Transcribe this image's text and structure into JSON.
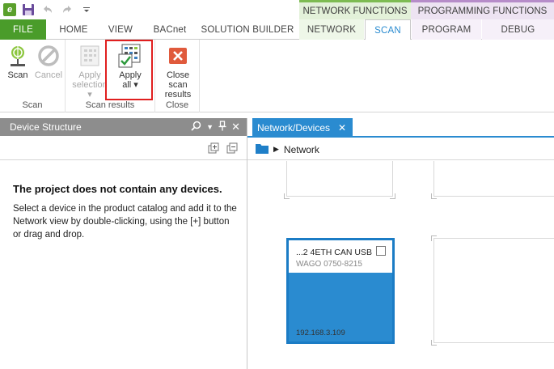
{
  "quick_access": {
    "icons": [
      "app-logo",
      "save-icon",
      "undo-icon",
      "redo-icon",
      "customize-dropdown-icon"
    ],
    "app_logo_text": "e"
  },
  "context_groups": {
    "network_functions": "NETWORK FUNCTIONS",
    "programming_functions": "PROGRAMMING FUNCTIONS"
  },
  "tabs": {
    "file": "FILE",
    "home": "HOME",
    "view": "VIEW",
    "bacnet": "BACnet",
    "solution_builder": "SOLUTION BUILDER",
    "network": "NETWORK",
    "scan": "SCAN",
    "program": "PROGRAM",
    "debug": "DEBUG",
    "active": "SCAN"
  },
  "ribbon": {
    "scan_group": {
      "label": "Scan",
      "scan_button": "Scan",
      "cancel_button": "Cancel"
    },
    "scan_results_group": {
      "label": "Scan results",
      "apply_selection_line1": "Apply",
      "apply_selection_line2": "selection",
      "apply_all_line1": "Apply",
      "apply_all_line2": "all"
    },
    "close_group": {
      "label": "Close",
      "close_scan_line1": "Close scan",
      "close_scan_line2": "results"
    }
  },
  "device_structure": {
    "title": "Device Structure",
    "empty_title": "The project does not contain any devices.",
    "empty_text": "Select a device in the product catalog and add it to the Network view by double-clicking, using the [+] button  or drag and drop."
  },
  "network_view": {
    "tab_label": "Network/Devices",
    "breadcrumb": "Network",
    "device": {
      "name": "...2 4ETH CAN USB",
      "vendor": "WAGO 0750-8215",
      "ip": "192.168.3.109"
    }
  },
  "colors": {
    "file_tab": "#4a9c2a",
    "accent_blue": "#2a8bd0",
    "highlight_red": "#e01f1f",
    "panel_header": "#8d8d8d",
    "network_ctx": "#e3f1d9",
    "programming_ctx": "#ede3f2"
  }
}
